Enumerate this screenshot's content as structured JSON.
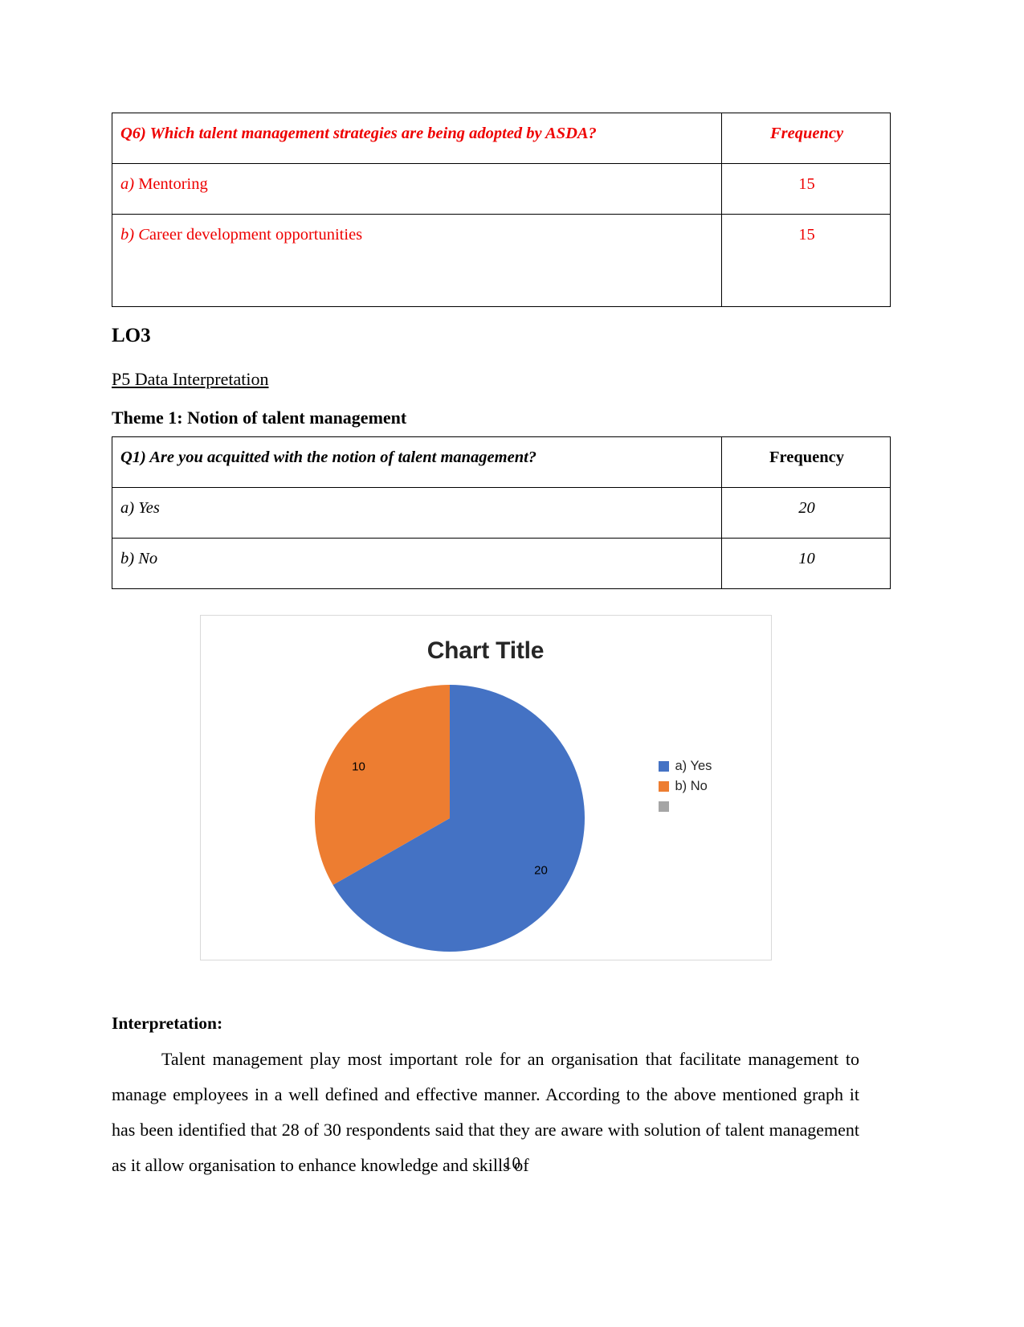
{
  "table_q6": {
    "header": {
      "question": "Q6) Which talent management strategies are being adopted by ASDA?",
      "frequency_label": "Frequency"
    },
    "rows": [
      {
        "lead": "a)",
        "text": " Mentoring",
        "frequency": "15"
      },
      {
        "lead": "b) C",
        "text": "areer development opportunities",
        "frequency": "15"
      }
    ],
    "text_color": "#EE0000"
  },
  "headings": {
    "lo3": "LO3",
    "p5": "P5 Data Interpretation",
    "theme1": "Theme 1:  Notion of talent management"
  },
  "table_q1": {
    "header": {
      "question": "Q1) Are you acquitted with the notion of talent management?",
      "frequency_label": "Frequency"
    },
    "rows": [
      {
        "text": "a) Yes",
        "frequency": "20"
      },
      {
        "text": "b) No",
        "frequency": "10"
      }
    ]
  },
  "chart_data": {
    "type": "pie",
    "title": "Chart Title",
    "categories": [
      "a) Yes",
      "b) No"
    ],
    "values": [
      20,
      10
    ],
    "data_labels": [
      "20",
      "10"
    ],
    "colors": [
      "#4472C4",
      "#ED7D31"
    ],
    "legend_position": "right",
    "legend_entries": [
      {
        "label": "a) Yes",
        "color": "#4472C4"
      },
      {
        "label": "b) No",
        "color": "#ED7D31"
      },
      {
        "label": "",
        "color": "#A5A5A5"
      }
    ],
    "total": 30,
    "start_angle_deg": 0,
    "grid": false
  },
  "interpretation": {
    "heading": "Interpretation:",
    "paragraph": "Talent management play most important role for an organisation that facilitate management to manage employees in a well defined and effective manner. According to the above mentioned graph it has been identified that 28 of 30 respondents said that they are aware with solution of talent management as it allow organisation to enhance knowledge and skills of"
  },
  "footer": {
    "page_number": "10"
  }
}
